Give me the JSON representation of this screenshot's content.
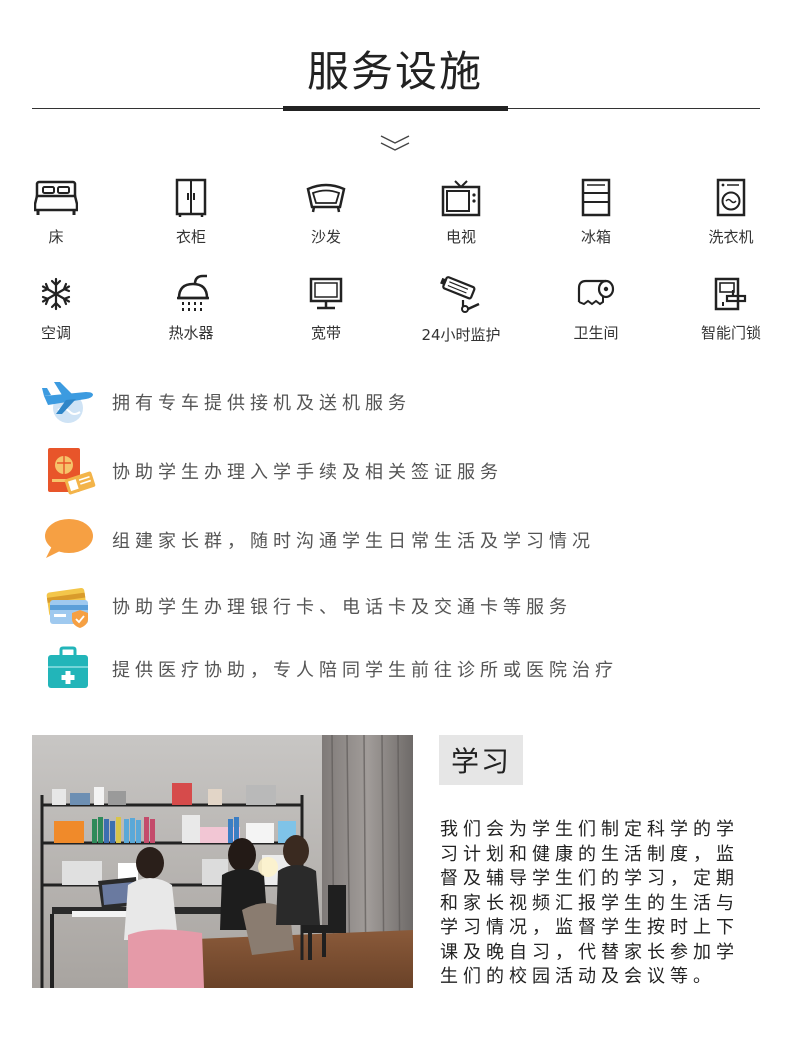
{
  "header": {
    "title": "服务设施"
  },
  "amenities": [
    {
      "label": "床",
      "icon": "bed-icon"
    },
    {
      "label": "衣柜",
      "icon": "wardrobe-icon"
    },
    {
      "label": "沙发",
      "icon": "sofa-icon"
    },
    {
      "label": "电视",
      "icon": "tv-icon"
    },
    {
      "label": "冰箱",
      "icon": "fridge-icon"
    },
    {
      "label": "洗衣机",
      "icon": "washing-machine-icon"
    },
    {
      "label": "空调",
      "icon": "air-conditioner-icon"
    },
    {
      "label": "热水器",
      "icon": "shower-icon"
    },
    {
      "label": "宽带",
      "icon": "monitor-icon"
    },
    {
      "label": "24小时监护",
      "icon": "cctv-camera-icon"
    },
    {
      "label": "卫生间",
      "icon": "toilet-paper-icon"
    },
    {
      "label": "智能门锁",
      "icon": "smart-lock-icon"
    }
  ],
  "services": [
    {
      "text": "拥有专车提供接机及送机服务",
      "icon": "airplane-icon"
    },
    {
      "text": "协助学生办理入学手续及相关签证服务",
      "icon": "passport-icon"
    },
    {
      "text": "组建家长群，随时沟通学生日常生活及学习情况",
      "icon": "chat-bubble-icon"
    },
    {
      "text": "协助学生办理银行卡、电话卡及交通卡等服务",
      "icon": "bank-card-icon"
    },
    {
      "text": "提供医疗协助，专人陪同学生前往诊所或医院治疗",
      "icon": "medical-kit-icon"
    }
  ],
  "study": {
    "heading": "学习",
    "body": "我们会为学生们制定科学的学习计划和健康的生活制度，监督及辅导学生们的学习，定期和家长视频汇报学生的生活与学习情况，监督学生按时上下课及晚自习，代替家长参加学生们的校园活动及会议等。"
  },
  "colors": {
    "blue_plane": "#3c9be0",
    "passport_orange": "#e8552a",
    "chat_orange": "#f6a043",
    "card_yellow": "#f3c64a",
    "medical_teal": "#22b5b9",
    "study_heading_bg": "#e6e6e6"
  }
}
